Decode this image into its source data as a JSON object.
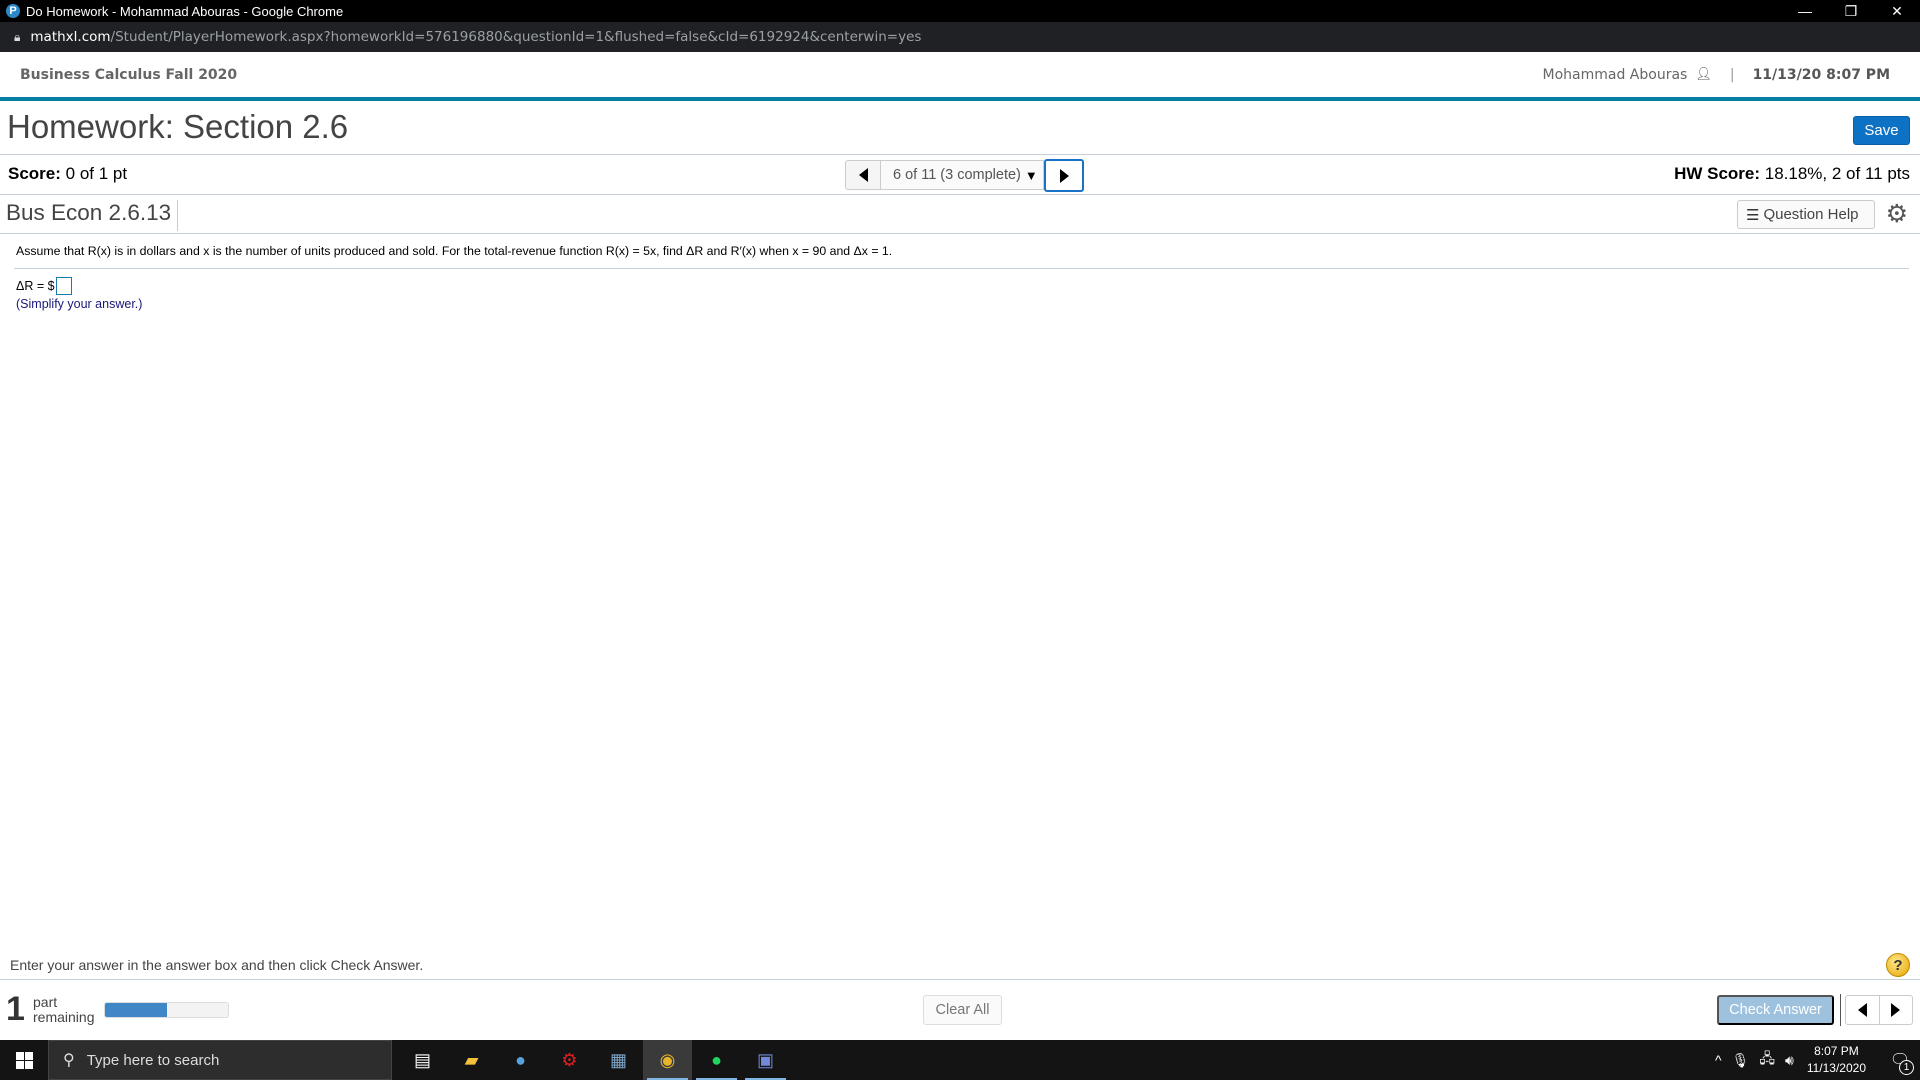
{
  "browser": {
    "window_title": "Do Homework - Mohammad Abouras - Google Chrome",
    "url_host": "mathxl.com",
    "url_path": "/Student/PlayerHomework.aspx?homeworkId=576196880&questionId=1&flushed=false&cId=6192924&centerwin=yes",
    "controls": {
      "minimize": "—",
      "restore": "❐",
      "close": "✕"
    }
  },
  "header": {
    "course": "Business Calculus Fall 2020",
    "user": "Mohammad Abouras",
    "separator": "|",
    "datetime": "11/13/20 8:07 PM"
  },
  "homework": {
    "title": "Homework: Section 2.6",
    "save_label": "Save",
    "score_label": "Score:",
    "score_value": "0 of 1 pt",
    "question_selector": "6 of 11 (3 complete)",
    "hw_score_label": "HW Score:",
    "hw_score_value": "18.18%, 2 of 11 pts"
  },
  "question": {
    "id": "Bus Econ 2.6.13",
    "help_label": "Question Help",
    "text": "Assume that R(x) is in dollars and x is the number of units produced and sold. For the total-revenue function R(x) = 5x, find ΔR and R′(x) when x = 90 and Δx = 1.",
    "answer_prefix": "ΔR = $",
    "answer_value": "",
    "hint": "(Simplify your answer.)"
  },
  "footer": {
    "instruction": "Enter your answer in the answer box and then click Check Answer.",
    "help_symbol": "?",
    "parts_remaining_count": "1",
    "parts_remaining_line1": "part",
    "parts_remaining_line2": "remaining",
    "progress_fraction": 0.5,
    "clear_all_label": "Clear All",
    "check_answer_label": "Check Answer"
  },
  "taskbar": {
    "search_placeholder": "Type here to search",
    "apps": [
      "task-view",
      "file-explorer",
      "steam",
      "app-red-gear",
      "calculator",
      "chrome",
      "spotify",
      "discord"
    ],
    "clock_time": "8:07 PM",
    "clock_date": "11/13/2020",
    "notification_count": "1"
  }
}
